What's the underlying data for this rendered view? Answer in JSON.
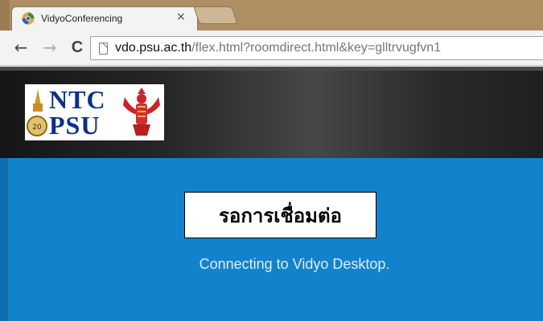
{
  "browser": {
    "tab": {
      "title": "VidyoConferencing",
      "close_glyph": "×",
      "favicon": "chrome-colored-icon"
    },
    "nav": {
      "back_glyph": "←",
      "forward_glyph": "→",
      "reload_glyph": "C"
    },
    "address": {
      "domain": "vdo.psu.ac.th",
      "path": "/flex.html?roomdirect.html&key=glltrvugfvn1"
    }
  },
  "header": {
    "logo": {
      "line1": "NTC",
      "line2": "PSU",
      "badge": "20"
    }
  },
  "main": {
    "status_thai": "รอการเชื่อมต่อ",
    "status_message": "Connecting to Vidyo Desktop."
  },
  "colors": {
    "tabstrip": "#ae8e63",
    "header": "#262626",
    "main_blue": "#1282cc",
    "logo_blue": "#0b2f8c"
  }
}
